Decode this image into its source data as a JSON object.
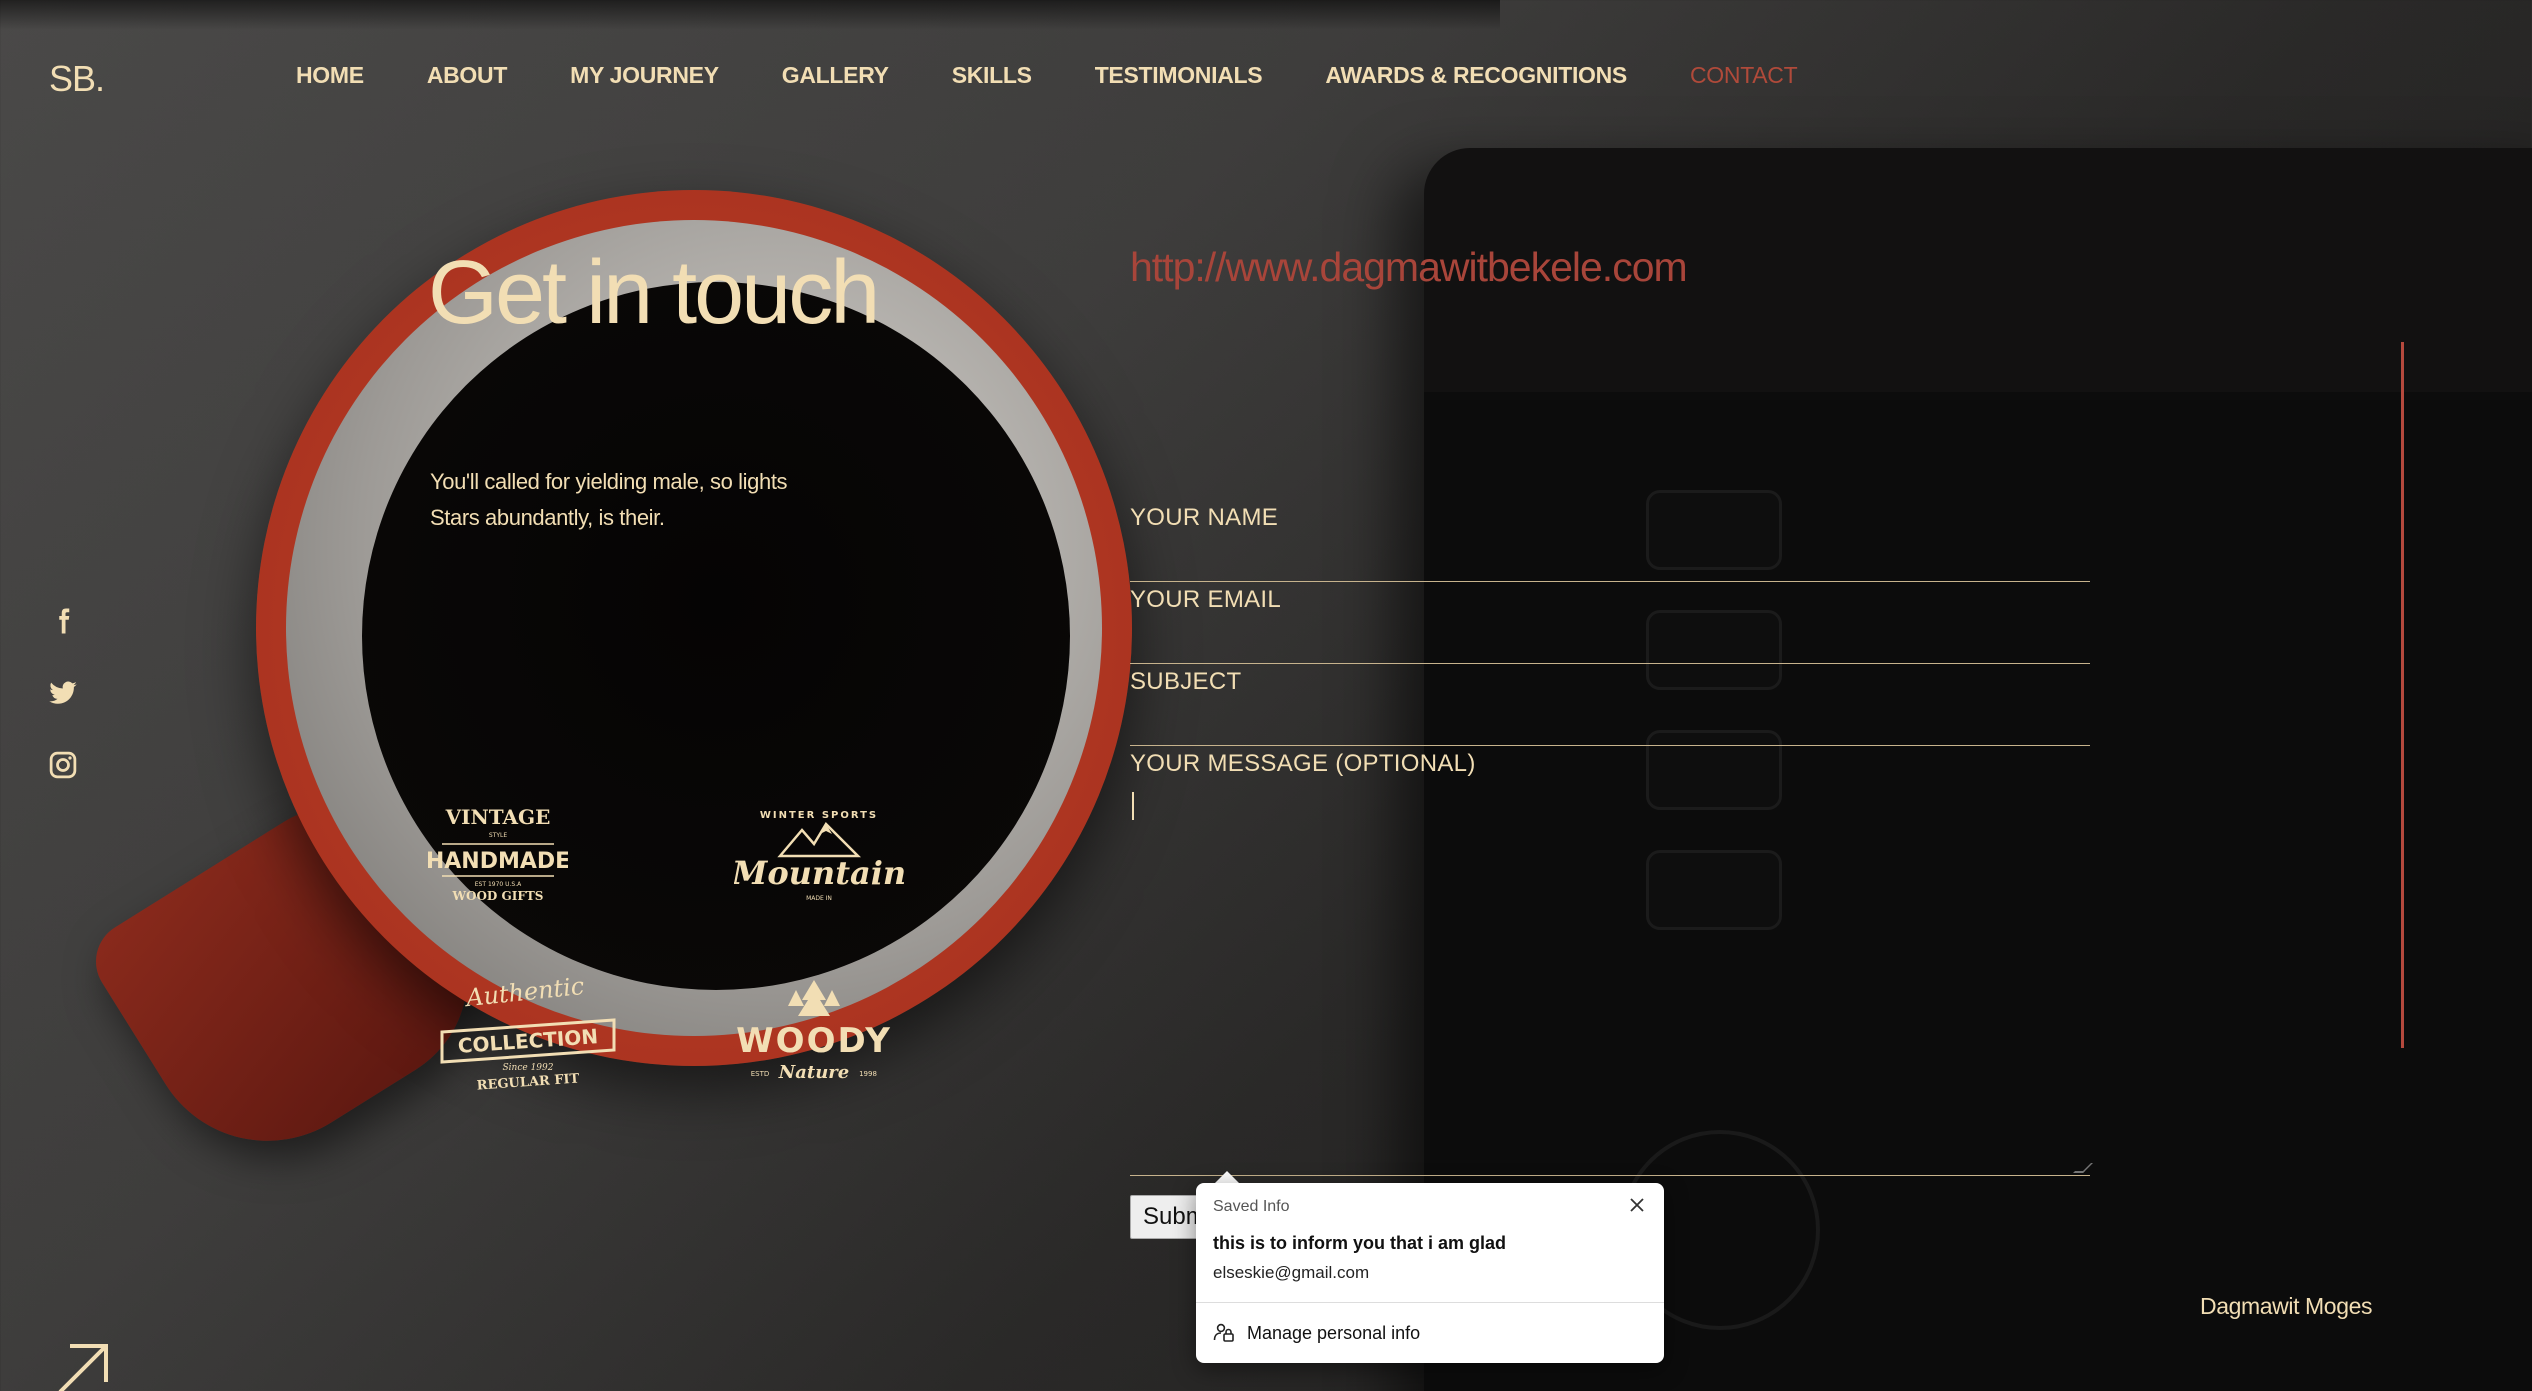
{
  "brand": {
    "logo_text": "SB."
  },
  "nav": {
    "items": [
      {
        "label": "HOME"
      },
      {
        "label": "ABOUT"
      },
      {
        "label": "MY JOURNEY"
      },
      {
        "label": "GALLERY"
      },
      {
        "label": "SKILLS"
      },
      {
        "label": "TESTIMONIALS"
      },
      {
        "label": "AWARDS & RECOGNITIONS"
      },
      {
        "label": "CONTACT",
        "active": true
      }
    ]
  },
  "social": {
    "icons": [
      "facebook-icon",
      "twitter-icon",
      "instagram-icon"
    ]
  },
  "contact": {
    "heading": "Get in touch",
    "intro_line1": "You'll called for yielding male, so lights",
    "intro_line2": "Stars abundantly, is their.",
    "website_url": "http://www.dagmawitbekele.com"
  },
  "partner_logos": {
    "handmade": {
      "top": "VINTAGE",
      "small": "STYLE",
      "main": "HANDMADE",
      "tag": "EST 1970 U.S.A",
      "bottom": "WOOD GIFTS"
    },
    "mountain": {
      "top": "WINTER SPORTS",
      "main": "Mountain",
      "tag": "MADE IN"
    },
    "collection": {
      "script": "Authentic",
      "main": "COLLECTION",
      "tag": "Since 1992",
      "bottom": "REGULAR FIT"
    },
    "woody": {
      "main": "WOODY",
      "script": "Nature",
      "est": "ESTD",
      "year": "1998"
    }
  },
  "form": {
    "name_label": "YOUR NAME",
    "email_label": "YOUR EMAIL",
    "subject_label": "SUBJECT",
    "message_label": "YOUR MESSAGE (OPTIONAL)",
    "submit_label": "Submit"
  },
  "autofill_popup": {
    "title": "Saved Info",
    "entry_primary": "this is to inform you that i am glad",
    "entry_secondary": "elseskie@gmail.com",
    "manage_label": "Manage personal info"
  },
  "footer": {
    "name": "Dagmawit Moges"
  },
  "colors": {
    "accent_cream": "#f2deb4",
    "accent_red": "#b04a3a",
    "background_dark": "#121111"
  }
}
